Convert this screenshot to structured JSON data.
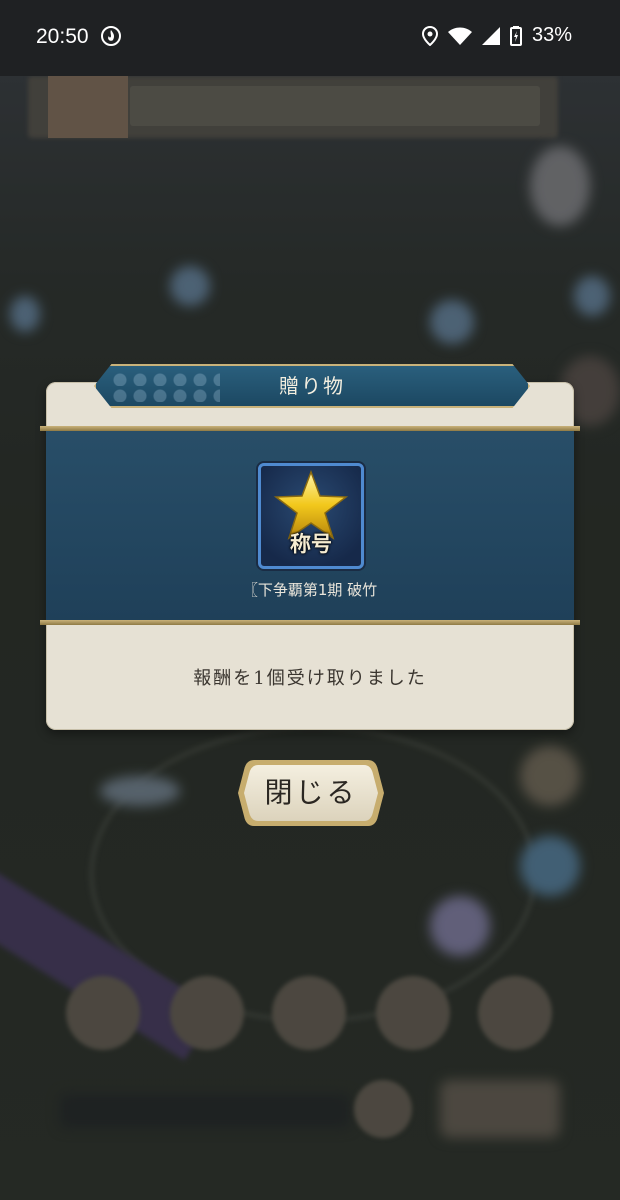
{
  "status_bar": {
    "time": "20:50",
    "battery": "33%",
    "icons": [
      "fire-icon",
      "location-icon",
      "wifi-icon",
      "signal-icon",
      "battery-icon"
    ]
  },
  "dialog": {
    "title": "贈り物",
    "item": {
      "icon": "star-icon",
      "badge_label": "称号",
      "name": "〖下争覇第1期 破竹"
    },
    "message": "報酬を1個受け取りました"
  },
  "close_button": {
    "label": "閉じる"
  },
  "colors": {
    "title_bar": "#1c4862",
    "blue_area": "#284e68",
    "panel": "#e6e1d4",
    "gold": "#c9b27a"
  }
}
